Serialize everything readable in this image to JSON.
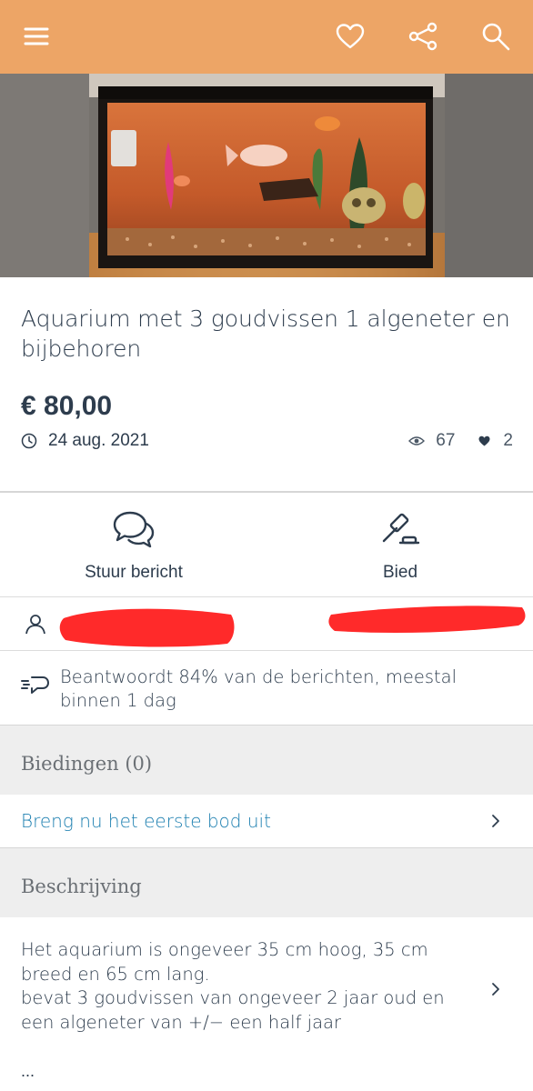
{
  "topbar": {
    "icons": [
      "menu-icon",
      "heart-icon",
      "share-icon",
      "search-icon"
    ],
    "bg_color": "#eda566"
  },
  "listing": {
    "title": "Aquarium met 3 goudvissen 1 algeneter en bijbehoren",
    "price": "€ 80,00",
    "date": "24 aug. 2021",
    "views": "67",
    "favorites": "2"
  },
  "actions": {
    "message_label": "Stuur bericht",
    "bid_label": "Bied"
  },
  "seller": {
    "response_text": "Beantwoordt 84% van de berichten, meestal binnen 1 dag"
  },
  "bids": {
    "heading": "Biedingen (0)",
    "cta": "Breng nu het eerste bod uit"
  },
  "description": {
    "heading": "Beschrijving",
    "text": "Het aquarium is ongeveer 35 cm hoog, 35 cm breed en 65 cm lang.\nbevat 3 goudvissen van ongeveer 2 jaar oud en een algeneter van +/− een half jaar",
    "more": "..."
  },
  "colors": {
    "link": "#1c7fb0",
    "text": "#2d3c4d",
    "redaction": "#ff2a2a"
  }
}
